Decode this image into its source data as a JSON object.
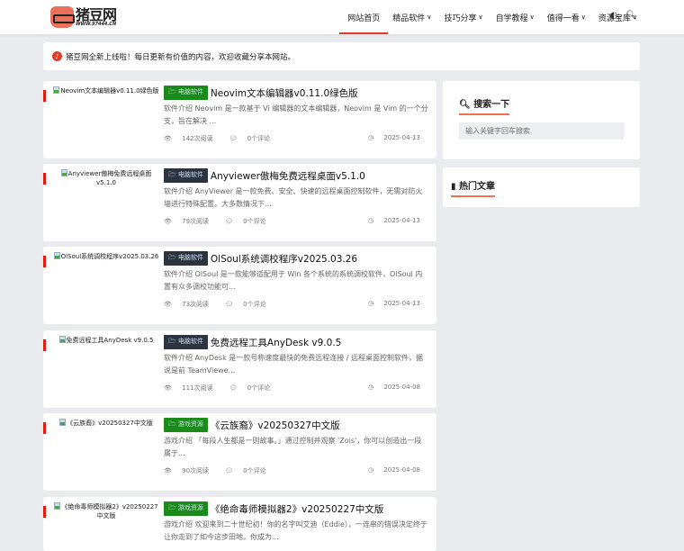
{
  "header": {
    "logo_main": "猪豆网",
    "logo_sub": "WWW.97444.CN",
    "nav": [
      {
        "label": "网站首页",
        "dropdown": false,
        "active": true
      },
      {
        "label": "精品软件",
        "dropdown": true
      },
      {
        "label": "技巧分享",
        "dropdown": true
      },
      {
        "label": "自学教程",
        "dropdown": true
      },
      {
        "label": "值得一看",
        "dropdown": true
      },
      {
        "label": "资源宝库",
        "dropdown": true
      }
    ],
    "icons": [
      "theme-toggle-icon",
      "search-icon"
    ]
  },
  "notice": {
    "text": "猪豆网全新上线啦！每日更新有价值的内容，欢迎收藏分享本网站。"
  },
  "colors": {
    "accent": "#e03c28",
    "badge_green": "#1a8a1a",
    "badge_dark": "#2c3440"
  },
  "posts": [
    {
      "thumb_alt": "Neovim文本编辑器v0.11.0绿色版",
      "category": "电脑软件",
      "badge_color": "#1a8a1a",
      "title": "Neovim文本编辑器v0.11.0绿色版",
      "excerpt": "软件介绍 Neovim 是一款基于 Vi 编辑器的文本编辑器，Neovim 是 Vim 的一个分支，旨在解决 ...",
      "views": "142次阅读",
      "comments": "0个评论",
      "date": "2025-04-13"
    },
    {
      "thumb_alt": "Anyviewer傲梅免费远程桌面v5.1.0",
      "category": "电脑软件",
      "badge_color": "#2c3440",
      "title": "Anyviewer傲梅免费远程桌面v5.1.0",
      "excerpt": "软件介绍 AnyViewer 是一款免费、安全、快速的远程桌面控制软件，无需对防火墙进行特殊配置。大多数情况下...",
      "views": "79次阅读",
      "comments": "0个评论",
      "date": "2025-04-13"
    },
    {
      "thumb_alt": "OlSoul系统调校程序v2025.03.26",
      "category": "电脑软件",
      "badge_color": "#2c3440",
      "title": "OlSoul系统调校程序v2025.03.26",
      "excerpt": "软件介绍 OlSoul 是一款能够适配用于 Win 各个系统的系统调校软件，OlSoul 内置有众多调校功能可...",
      "views": "73次阅读",
      "comments": "0个评论",
      "date": "2025-04-13"
    },
    {
      "thumb_alt": "免费远程工具AnyDesk v9.0.5",
      "category": "电脑软件",
      "badge_color": "#2c3440",
      "title": "免费远程工具AnyDesk v9.0.5",
      "excerpt": "软件介绍 AnyDesk 是一款号称速度最快的免费远程连接 / 远程桌面控制软件，据说是前 TeamViewe...",
      "views": "111次阅读",
      "comments": "0个评论",
      "date": "2025-04-08"
    },
    {
      "thumb_alt": "《云族裔》v20250327中文版",
      "category": "游戏资源",
      "badge_color": "#1a8a1a",
      "title": "《云族裔》v20250327中文版",
      "excerpt": "游戏介绍 「每段人生都是一则故事。」通过控制并观察 'Zois'，你可以创造出一段属于...",
      "views": "90次阅读",
      "comments": "0个评论",
      "date": "2025-04-08"
    },
    {
      "thumb_alt": "《绝命毒师模拟器2》v20250227中文版",
      "category": "游戏资源",
      "badge_color": "#1a8a1a",
      "title": "《绝命毒师模拟器2》v20250227中文版",
      "excerpt": "游戏介绍 欢迎来到二十世纪初！你的名字叫艾迪（Eddie），一连串的错误决定终于让你走到了如今这步田地，你成为...",
      "views": "",
      "comments": "",
      "date": ""
    }
  ],
  "sidebar": {
    "search_title": "搜索一下",
    "search_placeholder": "输入关键字回车搜索",
    "hot_title": "热门文章"
  }
}
